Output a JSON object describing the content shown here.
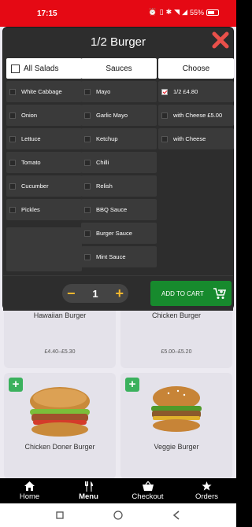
{
  "status_bar": {
    "time": "17:15",
    "battery": "55%"
  },
  "modal": {
    "title": "1/2 Burger",
    "salads": {
      "header": "All Salads",
      "items": [
        "White Cabbage",
        "Onion",
        "Lettuce",
        "Tomato",
        "Cucumber",
        "Pickles"
      ]
    },
    "sauces": {
      "header": "Sauces",
      "items": [
        "Mayo",
        "Garlic Mayo",
        "Ketchup",
        "Chilli",
        "Relish",
        "BBQ Sauce",
        "Burger Sauce",
        "Mint Sauce"
      ]
    },
    "choose": {
      "header": "Choose",
      "items": [
        "1/2 £4.80",
        "with Cheese £5.00",
        "with Cheese"
      ],
      "selected_index": 0
    },
    "quantity": "1",
    "decrement_symbol": "−",
    "increment_symbol": "+",
    "add_to_cart_label": "ADD TO CART"
  },
  "menu_cards": [
    {
      "name": "Hawaiian Burger",
      "price": "£4.40–£5.30"
    },
    {
      "name": "Chicken Burger",
      "price": "£5.00–£5.20"
    },
    {
      "name": "Chicken Doner Burger",
      "price": ""
    },
    {
      "name": "Veggie Burger",
      "price": ""
    }
  ],
  "bottom_nav": {
    "items": [
      {
        "label": "Home",
        "icon": "home-icon"
      },
      {
        "label": "Menu",
        "icon": "cutlery-icon"
      },
      {
        "label": "Checkout",
        "icon": "basket-icon"
      },
      {
        "label": "Orders",
        "icon": "star-icon"
      }
    ],
    "active_index": 1
  },
  "colors": {
    "status_bar": "#e50914",
    "modal_bg": "#2d2d2d",
    "accent_yellow": "#f5b82e",
    "cart_green": "#178a2d",
    "plus_green": "#3bb15d"
  }
}
